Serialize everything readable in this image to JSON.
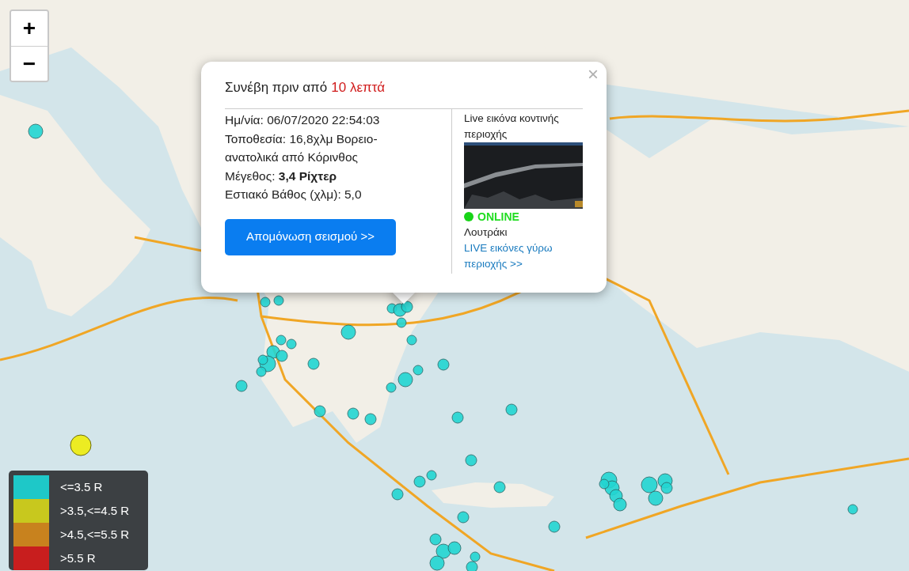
{
  "zoom_controls": [
    "+",
    "−"
  ],
  "popup": {
    "close": "×",
    "title": "Συνέβη πριν από",
    "time_ago": "10 λεπτά",
    "details": [
      "Ημ/νία: 06/07/2020 22:54:03",
      "Τοποθεσία: 16,8χλμ Βορειο-ανατολικά από Κόρινθος",
      "Μέγεθος: **3,4 Ρίχτερ**",
      "Εστιακό Βάθος (χλμ): 5,0"
    ],
    "button": "Απομόνωση σεισμού >>",
    "camera": {
      "heading": "Live εικόνα κοντινής περιοχής",
      "online": true,
      "status": "ONLINE",
      "place": "Λουτράκι",
      "link": "LIVE εικόνες γύρω περιοχής >>"
    }
  },
  "legend": [
    {
      "label": "<=3.5 R",
      "color": "#1ec8c8"
    },
    {
      "label": ">3.5,<=4.5 R",
      "color": "#c8c81e"
    },
    {
      "label": ">4.5,<=5.5 R",
      "color": "#c8821e"
    },
    {
      "label": ">5.5 R",
      "color": "#c81e1e"
    }
  ]
}
